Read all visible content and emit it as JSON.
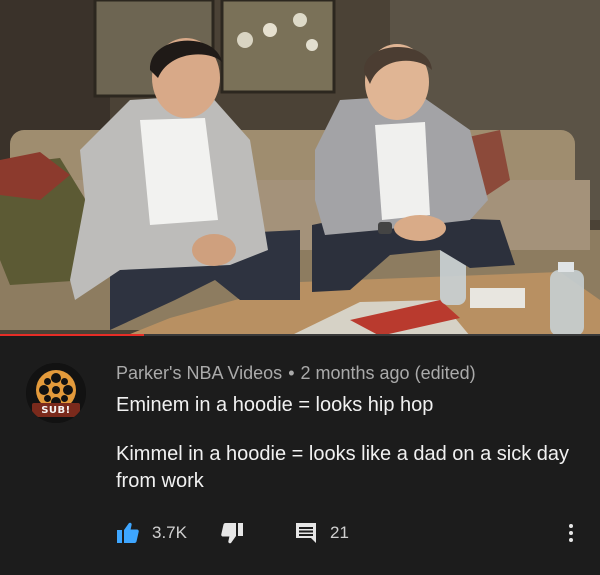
{
  "video": {
    "progress_fraction": 0.24
  },
  "comment": {
    "avatar_icon": "film-reel-icon",
    "avatar_badge": "SUB!",
    "author": "Parker's NBA Videos",
    "separator": "•",
    "timestamp": "2 months ago (edited)",
    "line1": "Eminem in a hoodie = looks hip hop",
    "line2": "Kimmel in a hoodie = looks like a dad on a sick day from work",
    "like_icon": "thumbs-up-icon",
    "like_count": "3.7K",
    "dislike_icon": "thumbs-down-icon",
    "reply_icon": "comment-icon",
    "reply_count": "21",
    "more_icon": "more-vert-icon",
    "accent_color": "#3ea6ff",
    "progress_color": "#e52d27"
  }
}
